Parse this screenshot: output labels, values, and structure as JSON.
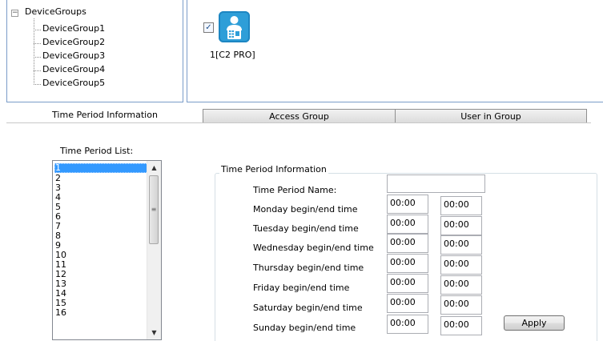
{
  "tree": {
    "root": "DeviceGroups",
    "toggle": "−",
    "items": [
      "DeviceGroup1",
      "DeviceGroup2",
      "DeviceGroup3",
      "DeviceGroup4",
      "DeviceGroup5"
    ]
  },
  "device": {
    "checked": "✓",
    "label": "1[C2 PRO]"
  },
  "tabs": {
    "time_period": "Time Period Information",
    "access_group": "Access Group",
    "user_in_group": "User in Group"
  },
  "list": {
    "title": "Time Period List:",
    "items": [
      "1",
      "2",
      "3",
      "4",
      "5",
      "6",
      "7",
      "8",
      "9",
      "10",
      "11",
      "12",
      "13",
      "14",
      "15",
      "16"
    ],
    "selected": "1"
  },
  "form": {
    "group_title": "Time Period Information",
    "name_label": "Time Period Name:",
    "name_value": "",
    "days": [
      {
        "label": "Monday begin/end time",
        "begin": "00:00",
        "end": "00:00"
      },
      {
        "label": "Tuesday begin/end time",
        "begin": "00:00",
        "end": "00:00"
      },
      {
        "label": "Wednesday begin/end time",
        "begin": "00:00",
        "end": "00:00"
      },
      {
        "label": "Thursday begin/end time",
        "begin": "00:00",
        "end": "00:00"
      },
      {
        "label": "Friday begin/end time",
        "begin": "00:00",
        "end": "00:00"
      },
      {
        "label": "Saturday begin/end time",
        "begin": "00:00",
        "end": "00:00"
      },
      {
        "label": "Sunday begin/end time",
        "begin": "00:00",
        "end": "00:00"
      }
    ],
    "apply_label": "Apply"
  }
}
